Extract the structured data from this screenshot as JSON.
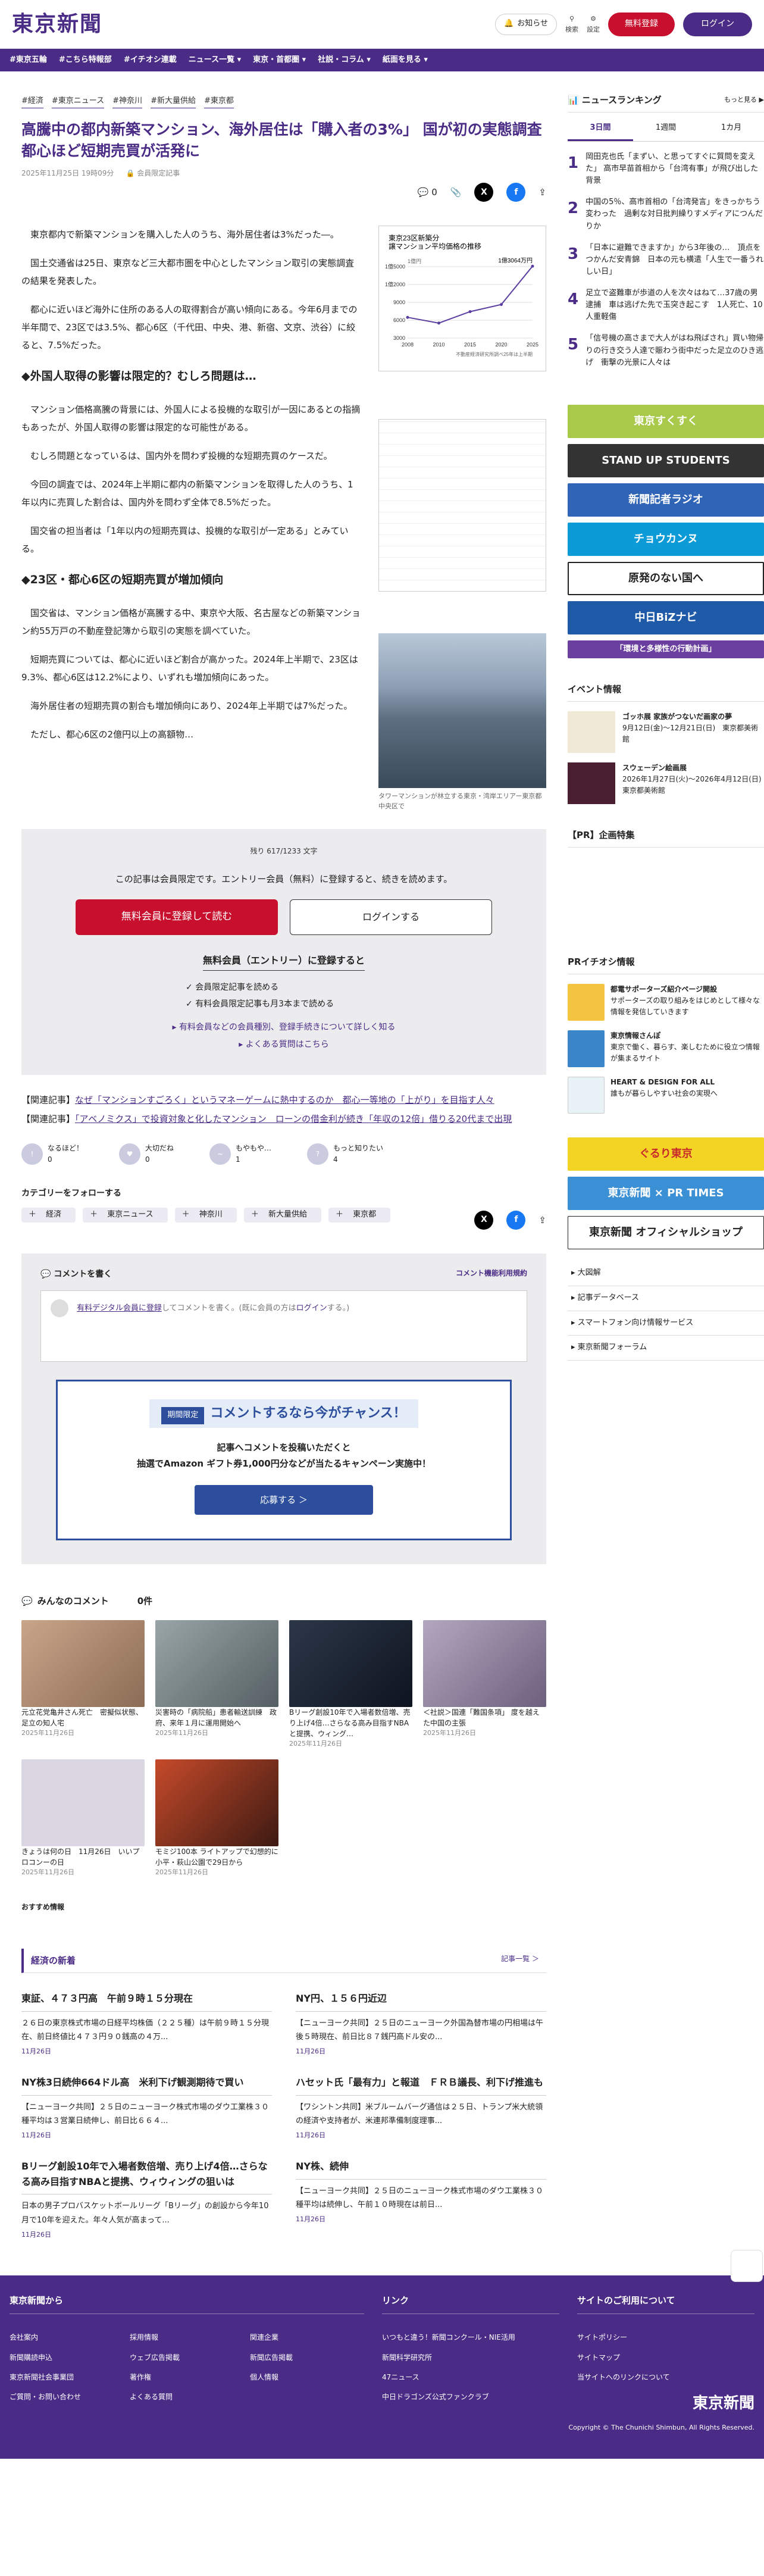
{
  "header": {
    "logo": "東京新聞",
    "notice_label": "お知らせ",
    "search_label": "検索",
    "settings_label": "設定",
    "register_label": "無料登録",
    "login_label": "ログイン"
  },
  "nav": [
    "#東京五輪",
    "#こちら特報部",
    "#イチオシ連載",
    "ニュース一覧 ▾",
    "東京・首都圏 ▾",
    "社説・コラム ▾",
    "紙面を見る ▾"
  ],
  "article": {
    "tags": [
      "#経済",
      "#東京ニュース",
      "#神奈川",
      "#新大量供給",
      "#東京都"
    ],
    "title": "高騰中の都内新築マンション、海外居住は「購入者の3%」 国が初の実態調査 都心ほど短期売買が活発に",
    "date": "2025年11月25日 19時09分",
    "member": "会員限定記事",
    "comment_count": "0",
    "p1": "東京都内で新築マンションを購入した人のうち、海外居住者は3%だった―。",
    "p2": "国土交通省は25日、東京など三大都市圏を中心としたマンション取引の実態調査の結果を発表した。",
    "p3": "都心に近いほど海外に住所のある人の取得割合が高い傾向にある。今年6月までの半年間で、23区では3.5%、都心6区（千代田、中央、港、新宿、文京、渋谷）に絞ると、7.5%だった。",
    "h2a": "◆外国人取得の影響は限定的？むしろ問題は…",
    "p4": "マンション価格高騰の背景には、外国人による投機的な取引が一因にあるとの指摘もあったが、外国人取得の影響は限定的な可能性がある。",
    "p5": "むしろ問題となっているは、国内外を問わず投機的な短期売買のケースだ。",
    "p6": "今回の調査では、2024年上半期に都内の新築マンションを取得した人のうち、1年以内に売買した割合は、国内外を問わず全体で8.5%だった。",
    "p7": "国交省の担当者は「1年以内の短期売買は、投機的な取引が一定ある」とみている。",
    "h2b": "◆23区・都心6区の短期売買が増加傾向",
    "p8": "国交省は、マンション価格が高騰する中、東京や大阪、名古屋などの新築マンション約55万戸の不動産登記簿から取引の実態を調べていた。",
    "p9": "短期売買については、都心に近いほど割合が高かった。2024年上半期で、23区は9.3%、都心6区は12.2%により、いずれも増加傾向にあった。",
    "p10": "海外居住者の短期売買の割合も増加傾向にあり、2024年上半期では7%だった。",
    "p11": "ただし、都心6区の2億円以上の高額物…",
    "photo_caption": "タワーマンションが林立する東京・湾岸エリアー東京都中央区で"
  },
  "chart_data": {
    "type": "line",
    "title": "東京23区新築分譲マンション平均価格の推移",
    "unit_label": "1億円",
    "annotation": "1億3064万円",
    "x": [
      "2008",
      "2010",
      "2015",
      "2020",
      "2025"
    ],
    "values": [
      5900,
      5100,
      6700,
      7700,
      13064
    ],
    "ylim": [
      3000,
      13000
    ],
    "yticks": [
      "3000",
      "6000",
      "9000",
      "1億2000",
      "1億5000"
    ],
    "source": "不動産経済研究所調べ25年は上半期"
  },
  "paywall": {
    "remaining": "残り 617/1233 文字",
    "message": "この記事は会員限定です。エントリー会員（無料）に登録すると、続きを読めます。",
    "register_btn": "無料会員に登録して読む",
    "login_btn": "ログインする",
    "sub_title": "無料会員（エントリー）に登録すると",
    "benefits": [
      "会員限定記事を読める",
      "有料会員限定記事も月3本まで読める"
    ],
    "link1": "有料会員などの会員種別、登録手続きについて詳しく知る",
    "link2": "よくある質問はこちら"
  },
  "related": [
    {
      "label": "【関連記事】",
      "text": "なぜ「マンションすごろく」というマネーゲームに熱中するのか　都心一等地の「上がり」を目指す人々"
    },
    {
      "label": "【関連記事】",
      "text": "「アベノミクス」で投資対象と化したマンション　ローンの借金利が続き「年収の12倍」借りる20代まで出現"
    }
  ],
  "reactions": [
    {
      "label": "なるほど！",
      "count": "0"
    },
    {
      "label": "大切だね",
      "count": "0"
    },
    {
      "label": "もやもや…",
      "count": "1"
    },
    {
      "label": "もっと知りたい",
      "count": "4"
    }
  ],
  "follow": {
    "title": "カテゴリーをフォローする",
    "tags": [
      "経済",
      "東京ニュース",
      "神奈川",
      "新大量供給",
      "東京都"
    ]
  },
  "comment": {
    "title": "コメントを書く",
    "rules": "コメント機能利用規約",
    "placeholder_link": "有料デジタル会員に登録",
    "placeholder_rest": "してコメントを書く。(既に会員の方は",
    "placeholder_login": "ログイン",
    "placeholder_end": "する。)",
    "camp_badge": "期間限定",
    "camp_title": "コメントするなら今がチャンス！",
    "camp_text1": "記事へコメントを投稿いただくと",
    "camp_text2": "抽選でAmazon ギフト券1,000円分などが当たるキャンペーン実施中！",
    "camp_btn": "応募する ＞"
  },
  "comments_section": {
    "title": "みんなのコメント",
    "count": "0件"
  },
  "cards": [
    {
      "text": "元立花党亀井さん死亡　密擬似状態、足立の知人宅",
      "date": "2025年11月26日"
    },
    {
      "text": "災害時の「病院船」患者輸送訓練　政府、来年１月に運用開始へ",
      "date": "2025年11月26日"
    },
    {
      "text": "Bリーグ創設10年で入場者数倍増、売り上げ4倍…さらなる高み目指すNBAと提携、ウィング…",
      "date": "2025年11月26日"
    },
    {
      "text": "＜社説＞国連「難国条項」 度を越えた中国の主張",
      "date": "2025年11月26日"
    },
    {
      "text": "きょうは何の日　11月26日　いいプロコンーの日",
      "date": "2025年11月26日"
    },
    {
      "text": "モミジ100本 ライトアップで幻想的に　小平・萩山公園で29日から",
      "date": "2025年11月26日"
    }
  ],
  "recommend_title": "おすすめ情報",
  "econ": {
    "title": "経済の新着",
    "more": "記事一覧 ＞",
    "items": [
      {
        "title": "東証、４７３円高　午前９時１５分現在",
        "body": "２６日の東京株式市場の日経平均株価（２２５種）は午前９時１５分現在、前日終値比４７３円９０銭高の４万...",
        "date": "11月26日"
      },
      {
        "title": "NY円、１５６円近辺",
        "body": "【ニューヨーク共同】２５日のニューヨーク外国為替市場の円相場は午後５時現在、前日比８７銭円高ドル安の...",
        "date": "11月26日"
      },
      {
        "title": "NY株3日続伸664ドル高　米利下げ観測期待で買い",
        "body": "【ニューヨーク共同】２５日のニューヨーク株式市場のダウ工業株３０種平均は３営業日続伸し、前日比６６４...",
        "date": "11月26日"
      },
      {
        "title": "ハセット氏「最有力」と報道　ＦＲＢ議長、利下げ推進も",
        "body": "【ワシントン共同】米ブルームバーグ通信は２５日、トランプ米大統領の経済や支持者が、米連邦準備制度理事...",
        "date": "11月26日"
      },
      {
        "title": "Bリーグ創設10年で入場者数倍増、売り上げ4倍…さらなる高み目指すNBAと提携、ウィウィングの狙いは",
        "body": "日本の男子プロバスケットボールリーグ「Bリーグ」の創設から今年10月で10年を迎えた。年々人気が高まって...",
        "date": "11月26日"
      },
      {
        "title": "NY株、続伸",
        "body": "【ニューヨーク共同】２５日のニューヨーク株式市場のダウ工業株３０種平均は続伸し、午前１０時現在は前日...",
        "date": "11月26日"
      }
    ]
  },
  "sidebar": {
    "ranking_title": "ニュースランキング",
    "ranking_more": "もっと見る ▶",
    "tabs": [
      "3日間",
      "1週間",
      "1カ月"
    ],
    "ranking": [
      "岡田克也氏「まずい、と思ってすぐに質問を変えた」 高市早苗首相から「台湾有事」が飛び出した背景",
      "中国の5％、高市首相の「台湾発言」をきっかちう変わった　過剰な対日批判繰りすメディアにつんだりか",
      "「日本に避難できますか」から3年後の…　頂点をつかんだ安青錦　日本の元も横遣「人生で一番うれしい日」",
      "足立で盗難車が歩道の人を次々はねて…37歳の男逮捕　車は逃げた先で玉突き起こす　1人死亡、10人重軽傷",
      "「信号機の高さまで大人がはね飛ばされ」買い物帰りの行き交う人達で賑わう街中だった足立のひき逃げ　衝撃の光景に人々は"
    ],
    "banners": [
      {
        "text": "東京すくすく",
        "color": "#a8c94a"
      },
      {
        "text": "STAND UP STUDENTS",
        "color": "#333333"
      },
      {
        "text": "新聞記者ラジオ",
        "color": "#2f64b6"
      },
      {
        "text": "チョウカンヌ",
        "color": "#0c9bd7"
      },
      {
        "text": "原発のない国へ",
        "color": "#222222"
      },
      {
        "text": "中日BiZナビ",
        "color": "#1f5aa8"
      },
      {
        "text": "「環境と多様性の行動計画」",
        "color": "#6b3fa0"
      }
    ],
    "event_title": "イベント情報",
    "events": [
      {
        "text": "ゴッホ展 家族がつないだ画家の夢",
        "meta": "9月12日(金)〜12月21日(日)　東京都美術館"
      },
      {
        "text": "スウェーデン絵画展",
        "meta": "2026年1月27日(火)〜2026年4月12日(日)　東京都美術館"
      }
    ],
    "pr_title": "【PR】企画特集",
    "pr_ichioshi_title": "PRイチオシ情報",
    "pr_items": [
      {
        "text": "都電サポーターズ紹介ページ開設",
        "sub": "サポーターズの取り組みをはじめとして様々な情報を発信していきます"
      },
      {
        "text": "東京情報さんぽ",
        "sub": "東京で働く、暮らす、楽しむために役立つ情報が集まるサイト"
      },
      {
        "text": "HEART & DESIGN FOR ALL",
        "sub": "誰もが暮らしやすい社会の実現へ"
      }
    ],
    "banners2": [
      {
        "text": "ぐるり東京",
        "color": "#f3d324"
      },
      {
        "text": "東京新聞 × PR TIMES",
        "color": "#3a8fd5"
      },
      {
        "text": "東京新聞 オフィシャルショップ",
        "color": "#ffffff"
      }
    ],
    "links": [
      "大図解",
      "記事データベース",
      "スマートフォン向け情報サービス",
      "東京新聞フォーラム"
    ]
  },
  "footer": {
    "col1_title": "東京新聞から",
    "col1": [
      "会社案内",
      "採用情報",
      "関連企業",
      "新聞購読申込",
      "ウェブ広告掲載",
      "新聞広告掲載",
      "東京新聞社会事業団",
      "著作権",
      "個人情報",
      "ご質問・お問い合わせ",
      "よくある質問"
    ],
    "col2_title": "リンク",
    "col2": [
      "いつもと違う！新聞コンクール・NIE活用",
      "新聞科学研究所",
      "47ニュース",
      "中日ドラゴンズ公式ファンクラブ"
    ],
    "col3_title": "サイトのご利用について",
    "col3": [
      "サイトポリシー",
      "サイトマップ",
      "当サイトへのリンクについて"
    ],
    "logo": "東京新聞",
    "copyright": "Copyright © The Chunichi Shimbun, All Rights Reserved."
  }
}
